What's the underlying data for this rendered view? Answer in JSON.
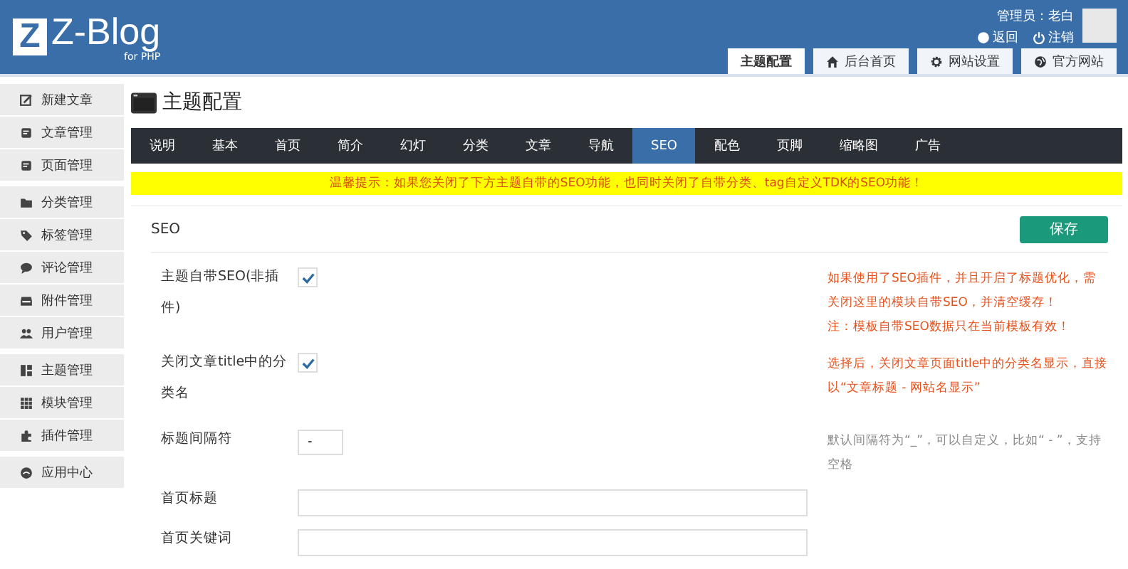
{
  "header": {
    "logo_mark": "Z",
    "logo_text": "Z-Blog",
    "logo_sub": "for PHP",
    "user_label": "管理员：老白",
    "links": [
      {
        "label": "返回"
      },
      {
        "label": "注销"
      }
    ],
    "tabs": [
      {
        "label": "主题配置",
        "selected": true
      },
      {
        "label": "后台首页",
        "selected": false
      },
      {
        "label": "网站设置",
        "selected": false
      },
      {
        "label": "官方网站",
        "selected": false
      }
    ]
  },
  "sidebar": {
    "groups": [
      [
        {
          "label": "新建文章"
        },
        {
          "label": "文章管理"
        },
        {
          "label": "页面管理"
        }
      ],
      [
        {
          "label": "分类管理"
        },
        {
          "label": "标签管理"
        },
        {
          "label": "评论管理"
        },
        {
          "label": "附件管理"
        },
        {
          "label": "用户管理"
        }
      ],
      [
        {
          "label": "主题管理"
        },
        {
          "label": "模块管理"
        },
        {
          "label": "插件管理"
        }
      ],
      [
        {
          "label": "应用中心"
        }
      ]
    ]
  },
  "page_title": "主题配置",
  "nav": [
    {
      "label": "说明",
      "selected": false
    },
    {
      "label": "基本",
      "selected": false
    },
    {
      "label": "首页",
      "selected": false
    },
    {
      "label": "简介",
      "selected": false
    },
    {
      "label": "幻灯",
      "selected": false
    },
    {
      "label": "分类",
      "selected": false
    },
    {
      "label": "文章",
      "selected": false
    },
    {
      "label": "导航",
      "selected": false
    },
    {
      "label": "SEO",
      "selected": true
    },
    {
      "label": "配色",
      "selected": false
    },
    {
      "label": "页脚",
      "selected": false
    },
    {
      "label": "缩略图",
      "selected": false
    },
    {
      "label": "广告",
      "selected": false
    }
  ],
  "notice": "温馨提示：如果您关闭了下方主题自带的SEO功能，也同时关闭了自带分类、tag自定义TDK的SEO功能！",
  "section": {
    "title": "SEO",
    "save_button": "保存",
    "rows": [
      {
        "kind": "checkbox",
        "label": "主题自带SEO(非插件)",
        "checked": true,
        "help": [
          {
            "text": "如果使用了SEO插件，并且开启了标题优化，需关闭这里的模块自带SEO，并清空缓存！",
            "kind": "warning"
          },
          {
            "text": "注：模板自带SEO数据只在当前模板有效！",
            "kind": "warning"
          }
        ]
      },
      {
        "kind": "checkbox",
        "label": "关闭文章title中的分类名",
        "checked": true,
        "help": [
          {
            "text": "选择后，关闭文章页面title中的分类名显示，直接以“文章标题 - 网站名显示”",
            "kind": "warning"
          }
        ]
      },
      {
        "kind": "short",
        "label": "标题间隔符",
        "value": "-",
        "help": [
          {
            "text": "默认间隔符为“_”，可以自定义，比如“ - ”，支持空格",
            "kind": "note"
          }
        ]
      },
      {
        "kind": "wide",
        "label": "首页标题"
      },
      {
        "kind": "wide",
        "label": "首页关键词"
      }
    ]
  }
}
